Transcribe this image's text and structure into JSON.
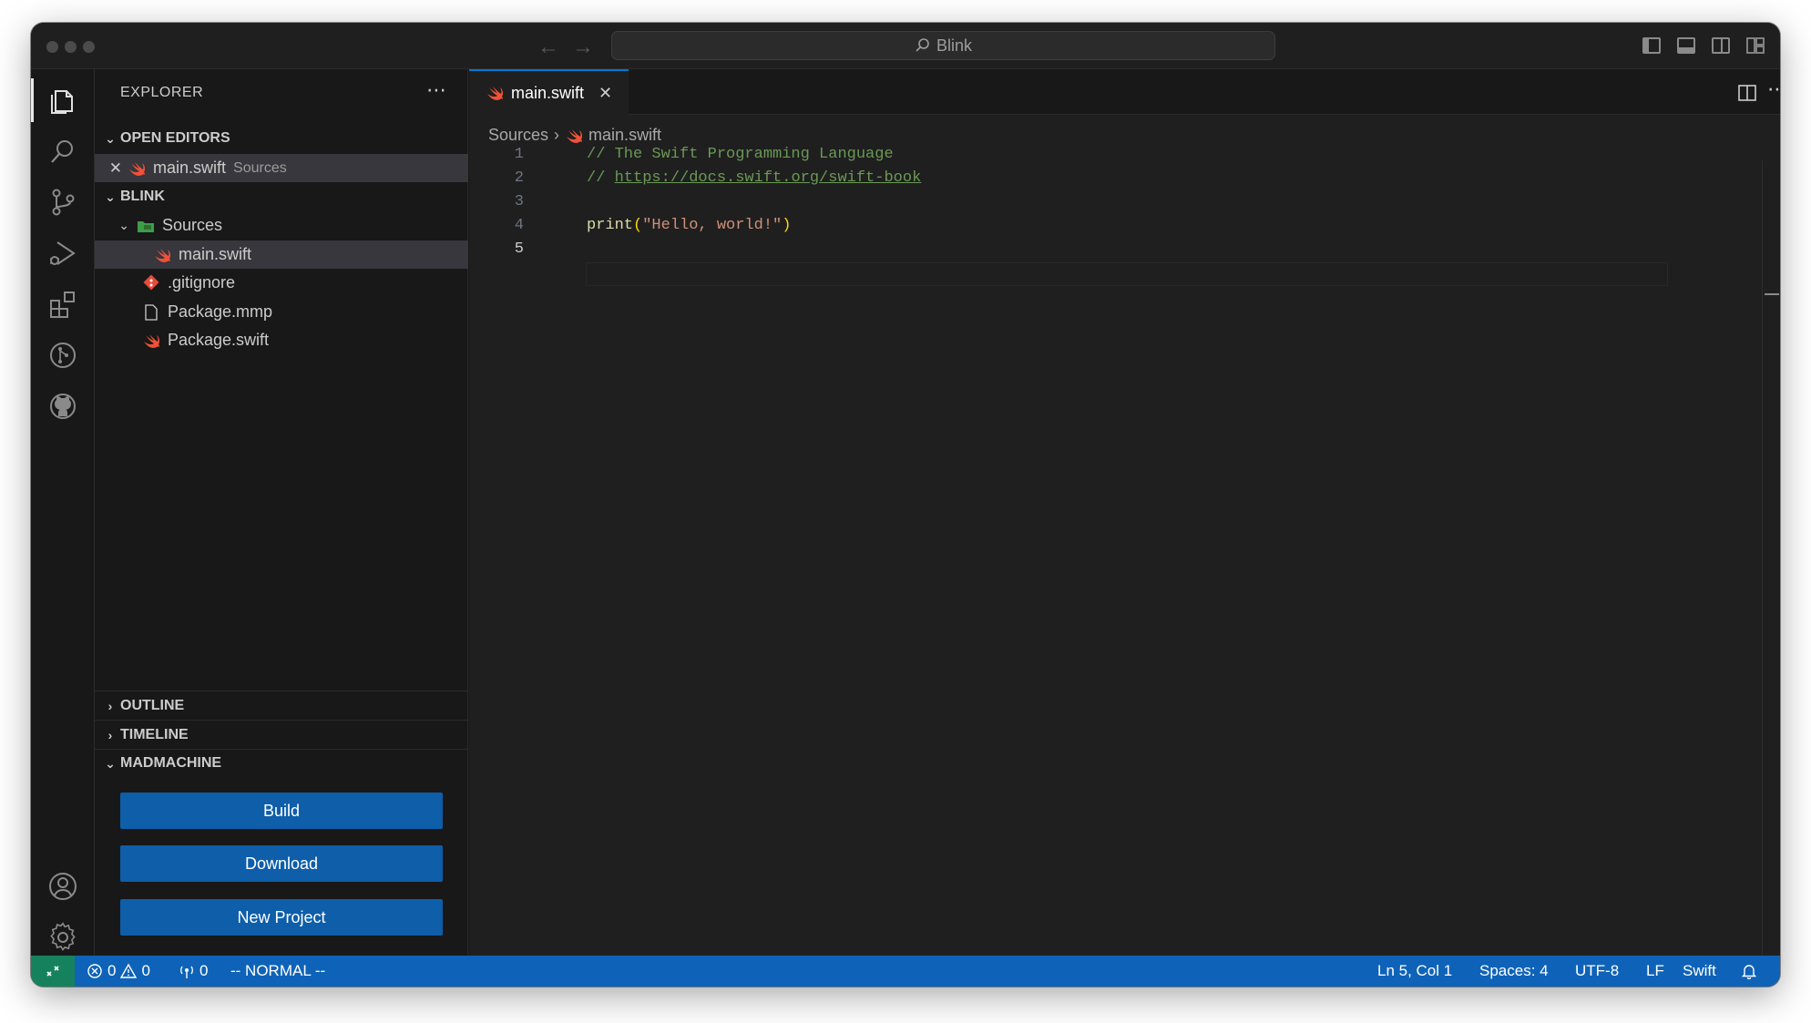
{
  "window": {
    "command_center": "Blink"
  },
  "sidebar": {
    "title": "EXPLORER",
    "open_editors_header": "OPEN EDITORS",
    "open_editor": {
      "name": "main.swift",
      "desc": "Sources"
    },
    "project_header": "BLINK",
    "tree": [
      {
        "name": "Sources",
        "kind": "folder"
      },
      {
        "name": "main.swift",
        "kind": "swift"
      },
      {
        "name": ".gitignore",
        "kind": "git"
      },
      {
        "name": "Package.mmp",
        "kind": "file"
      },
      {
        "name": "Package.swift",
        "kind": "swift"
      }
    ],
    "outline_header": "OUTLINE",
    "timeline_header": "TIMELINE",
    "madmachine_header": "MADMACHINE",
    "buttons": {
      "build": "Build",
      "download": "Download",
      "new_project": "New Project"
    }
  },
  "editor": {
    "tab_label": "main.swift",
    "breadcrumb": {
      "folder": "Sources",
      "file": "main.swift"
    },
    "line_numbers": [
      "1",
      "2",
      "3",
      "4",
      "5"
    ],
    "code": {
      "line1": "// The Swift Programming Language",
      "line2_prefix": "// ",
      "line2_link": "https://docs.swift.org/swift-book",
      "line4_fn": "print",
      "line4_open": "(",
      "line4_str": "\"Hello, world!\"",
      "line4_close": ")"
    }
  },
  "statusbar": {
    "errors": "0",
    "warnings": "0",
    "ports": "0",
    "mode": "-- NORMAL --",
    "position": "Ln 5, Col 1",
    "spaces": "Spaces: 4",
    "encoding": "UTF-8",
    "eol": "LF",
    "language": "Swift"
  },
  "colors": {
    "accent": "#0078d4",
    "statusbar": "#0e63b8",
    "button": "#0e5eaa",
    "swift": "#f05138"
  }
}
